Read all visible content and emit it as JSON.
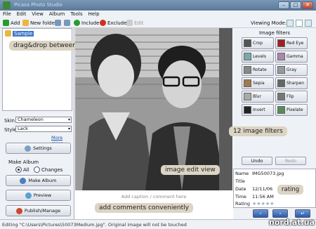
{
  "window": {
    "title": "Picasa Photo Studio"
  },
  "menu": [
    "File",
    "Edit",
    "View",
    "Album",
    "Tools",
    "Help"
  ],
  "toolbar": {
    "add": "Add",
    "new_folder": "New folder",
    "include": "Include",
    "exclude": "Exclude",
    "edit": "Edit",
    "viewing_mode": "Viewing Mode:"
  },
  "tree": {
    "root": "Sample"
  },
  "left": {
    "skin_label": "Skin",
    "skin_value": "Chameleon",
    "style_label": "Style",
    "style_value": "Lack",
    "more_skins": "More skins",
    "settings": "Settings",
    "make_album_label": "Make Album",
    "radio_all": "All",
    "radio_changes": "Changes",
    "make_album": "Make Album",
    "preview": "Preview",
    "publish": "Publish/Manage"
  },
  "filters": {
    "title": "Image filters",
    "items": [
      "Crop",
      "Red Eye",
      "Levels",
      "Gamma",
      "Rotate",
      "Gray",
      "Sepia",
      "Sharpen",
      "Blur",
      "Flip",
      "Invert",
      "Pixelate"
    ]
  },
  "edit": {
    "undo": "Undo",
    "redo": "Redo"
  },
  "info": {
    "name_label": "Name",
    "name_value": "IMG50073.jpg",
    "title_label": "Title",
    "title_value": "",
    "date_label": "Date",
    "date_value": "12/11/06",
    "time_label": "Time",
    "time_value": "11:56 AM",
    "rating_label": "Rating",
    "rating_value": 0,
    "rating_max": 5
  },
  "caption_placeholder": "Add caption / comment here",
  "status": "Editing \"C:\\Users\\Pictures\\50073Medium.jpg\". Original image will not be touched",
  "callouts": {
    "drag": "drag&drop between folders",
    "filters": "12 image filters",
    "edit_view": "image edit view",
    "rating": "rating",
    "comments": "add comments conveniently"
  },
  "watermark": "nord.at.ua",
  "colors": {
    "titlebar": "#6a88a8",
    "nav": "#2a5aa8",
    "selection": "#3a78c8",
    "callout": "#dcd4c4"
  }
}
